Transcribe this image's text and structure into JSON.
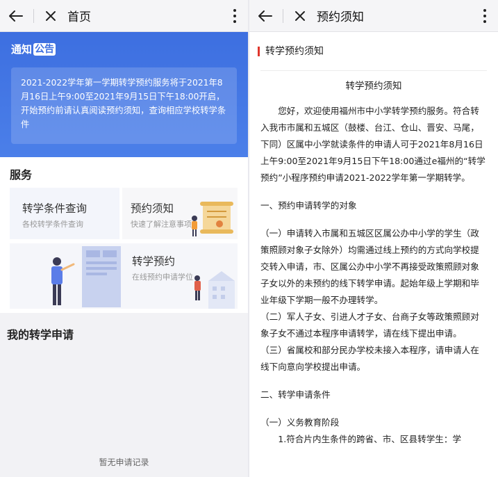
{
  "left": {
    "header": {
      "title": "首页"
    },
    "notice": {
      "label": "通知",
      "tag": "公告",
      "text": "2021-2022学年第一学期转学预约服务将于2021年8月16日上午9:00至2021年9月15日下午18:00开启，开始预约前请认真阅读预约须知，查询相应学校转学条件"
    },
    "services": {
      "title": "服务",
      "items": [
        {
          "title": "转学条件查询",
          "subtitle": "各校转学条件查询"
        },
        {
          "title": "预约须知",
          "subtitle": "快速了解注意事项"
        },
        {
          "title": "转学预约",
          "subtitle": "在线预约申请学位"
        }
      ]
    },
    "my_applications": {
      "title": "我的转学申请",
      "empty_text": "暂无申请记录"
    }
  },
  "right": {
    "header": {
      "title": "预约须知"
    },
    "section_label": "转学预约须知",
    "doc_title": "转学预约须知",
    "paragraphs": {
      "intro": "您好，欢迎使用福州市中小学转学预约服务。符合转入我市市属和五城区（鼓楼、台江、仓山、晋安、马尾，下同）区属中小学就读条件的申请人可于2021年8月16日上午9:00至2021年9月15日下午18:00通过e福州的“转学预约”小程序预约申请2021-2022学年第一学期转学。",
      "h1": "一、预约申请转学的对象",
      "p1": "（一）申请转入市属和五城区区属公办中小学的学生（政策照顾对象子女除外）均需通过线上预约的方式向学校提交转入申请，市、区属公办中小学不再接受政策照顾对象子女以外的未预约的线下转学申请。起始年级上学期和毕业年级下学期一般不办理转学。",
      "p2": "（二）军人子女、引进人才子女、台商子女等政策照顾对象子女不通过本程序申请转学，请在线下提出申请。",
      "p3": "（三）省属校和部分民办学校未接入本程序，请申请人在线下向意向学校提出申请。",
      "h2": "二、转学申请条件",
      "h2a": "（一）义务教育阶段",
      "p4": "1.符合片内生条件的跨省、市、区县转学生：学"
    }
  }
}
